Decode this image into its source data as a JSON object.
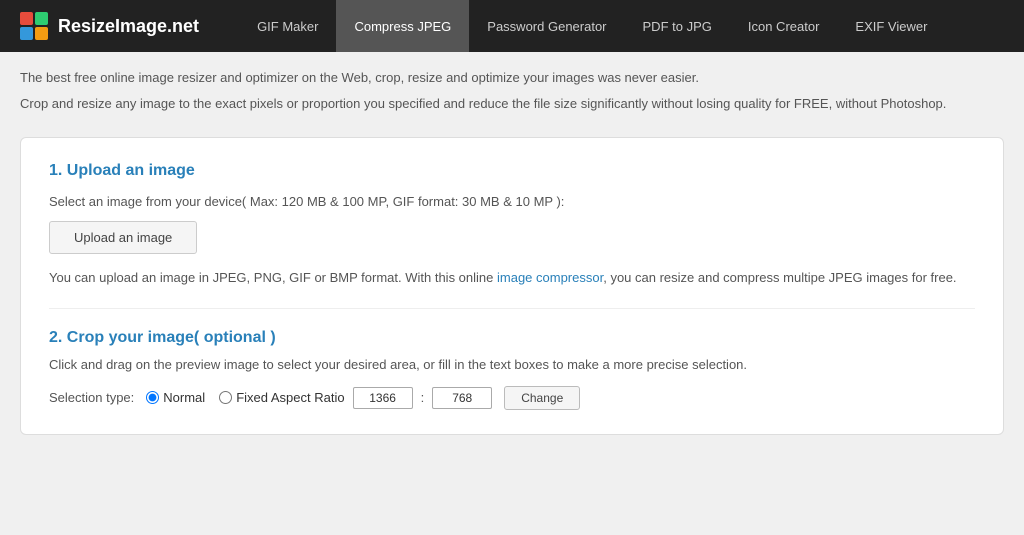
{
  "header": {
    "logo_text": "ResizeImage.net",
    "nav_items": [
      {
        "label": "GIF Maker",
        "id": "gif-maker"
      },
      {
        "label": "Compress JPEG",
        "id": "compress-jpeg",
        "active": true
      },
      {
        "label": "Password Generator",
        "id": "password-generator"
      },
      {
        "label": "PDF to JPG",
        "id": "pdf-to-jpg"
      },
      {
        "label": "Icon Creator",
        "id": "icon-creator"
      },
      {
        "label": "EXIF Viewer",
        "id": "exif-viewer"
      }
    ]
  },
  "main": {
    "intro_line1": "The best free online image resizer and optimizer on the Web, crop, resize and optimize your images was never easier.",
    "intro_line2_part1": "Crop and resize any image to the exact pixels or proportion you specified and reduce the file size significantly without losing quality for FREE, without Photoshop.",
    "section1": {
      "title": "1. Upload an image",
      "desc": "Select an image from your device( Max: 120 MB & 100 MP, GIF format: 30 MB & 10 MP ):",
      "upload_btn": "Upload an image",
      "note_part1": "You can upload an image in JPEG, PNG, GIF or BMP format. With this online ",
      "note_link": "image compressor",
      "note_part2": ", you can resize and compress multipe JPEG images for free."
    },
    "section2": {
      "title": "2. Crop your image( optional )",
      "desc": "Click and drag on the preview image to select your desired area, or fill in the text boxes to make a more precise selection.",
      "selection_label": "Selection type:",
      "radio_normal": "Normal",
      "radio_aspect": "Fixed Aspect Ratio",
      "coord_width": "1366",
      "coord_height": "768",
      "change_btn": "Change"
    }
  }
}
